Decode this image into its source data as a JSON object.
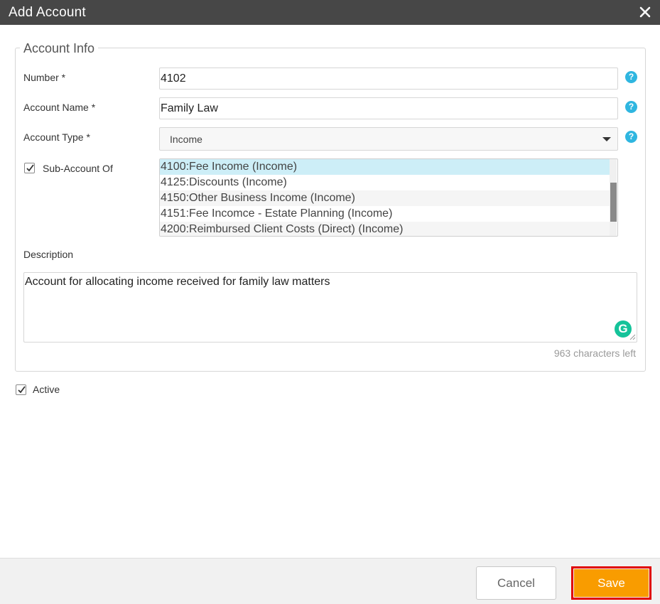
{
  "dialog": {
    "title": "Add Account",
    "close_icon": "close-icon"
  },
  "fieldset": {
    "legend": "Account Info"
  },
  "number": {
    "label": "Number *",
    "value": "4102"
  },
  "account_name": {
    "label": "Account Name *",
    "value": "Family Law"
  },
  "account_type": {
    "label": "Account Type *",
    "selected": "Income"
  },
  "sub_account": {
    "label": "Sub-Account Of",
    "checked": true,
    "options": [
      "4100:Fee Income (Income)",
      "4125:Discounts (Income)",
      "4150:Other Business Income (Income)",
      "4151:Fee Incomce - Estate Planning (Income)",
      "4200:Reimbursed Client Costs (Direct) (Income)"
    ],
    "selected_index": 0
  },
  "description": {
    "label": "Description",
    "value": "Account for allocating income received for family law matters",
    "chars_left": "963 characters left",
    "grammarly_letter": "G"
  },
  "active": {
    "label": "Active",
    "checked": true
  },
  "help_glyph": "?",
  "footer": {
    "cancel_label": "Cancel",
    "save_label": "Save"
  },
  "colors": {
    "titlebar": "#474747",
    "help_icon": "#2fb6e0",
    "selected_option": "#cdeef7",
    "save_button": "#f99c00",
    "save_highlight": "#e00000",
    "grammarly": "#15c39a"
  }
}
